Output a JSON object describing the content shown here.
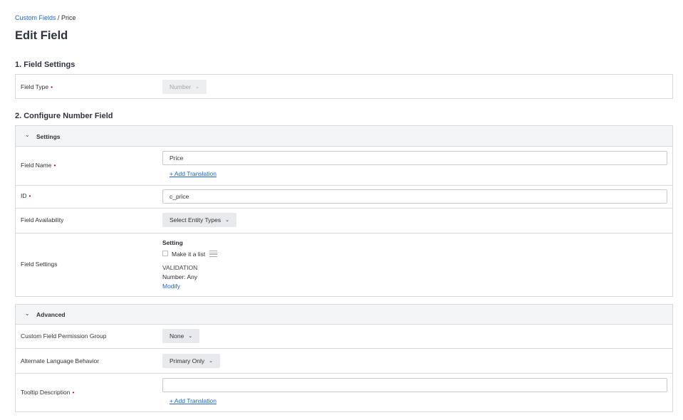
{
  "breadcrumb": {
    "parent": "Custom Fields",
    "separator": " / ",
    "current": "Price"
  },
  "page_title": "Edit Field",
  "section1": {
    "title": "1. Field Settings",
    "field_type": {
      "label": "Field Type",
      "required": "•",
      "value": "Number"
    }
  },
  "section2": {
    "title": "2. Configure Number Field",
    "settings_header": "Settings",
    "field_name": {
      "label": "Field Name",
      "required": "•",
      "value": "Price",
      "add_translation": "+ Add Translation"
    },
    "id": {
      "label": "ID",
      "required": "•",
      "value": "c_price"
    },
    "field_availability": {
      "label": "Field Availability",
      "button": "Select Entity Types"
    },
    "field_settings": {
      "label": "Field Settings",
      "setting_heading": "Setting",
      "make_list_label": "Make it a list",
      "validation_heading": "VALIDATION",
      "validation_value": "Number: Any",
      "modify_link": "Modify"
    },
    "advanced_header": "Advanced",
    "permission_group": {
      "label": "Custom Field Permission Group",
      "value": "None"
    },
    "alternate_language": {
      "label": "Alternate Language Behavior",
      "value": "Primary Only"
    },
    "tooltip": {
      "label": "Tooltip Description",
      "required": "•",
      "value": "",
      "add_translation": "+ Add Translation"
    }
  },
  "colors": {
    "link": "#1a66cc",
    "required": "#d0021b",
    "border": "#d7d9de",
    "header_bg": "#f4f5f7",
    "button_bg": "#e8e9ec"
  },
  "icons": {
    "collapse": "chevron-down-icon",
    "dropdown": "caret-down-icon",
    "list": "list-icon"
  }
}
